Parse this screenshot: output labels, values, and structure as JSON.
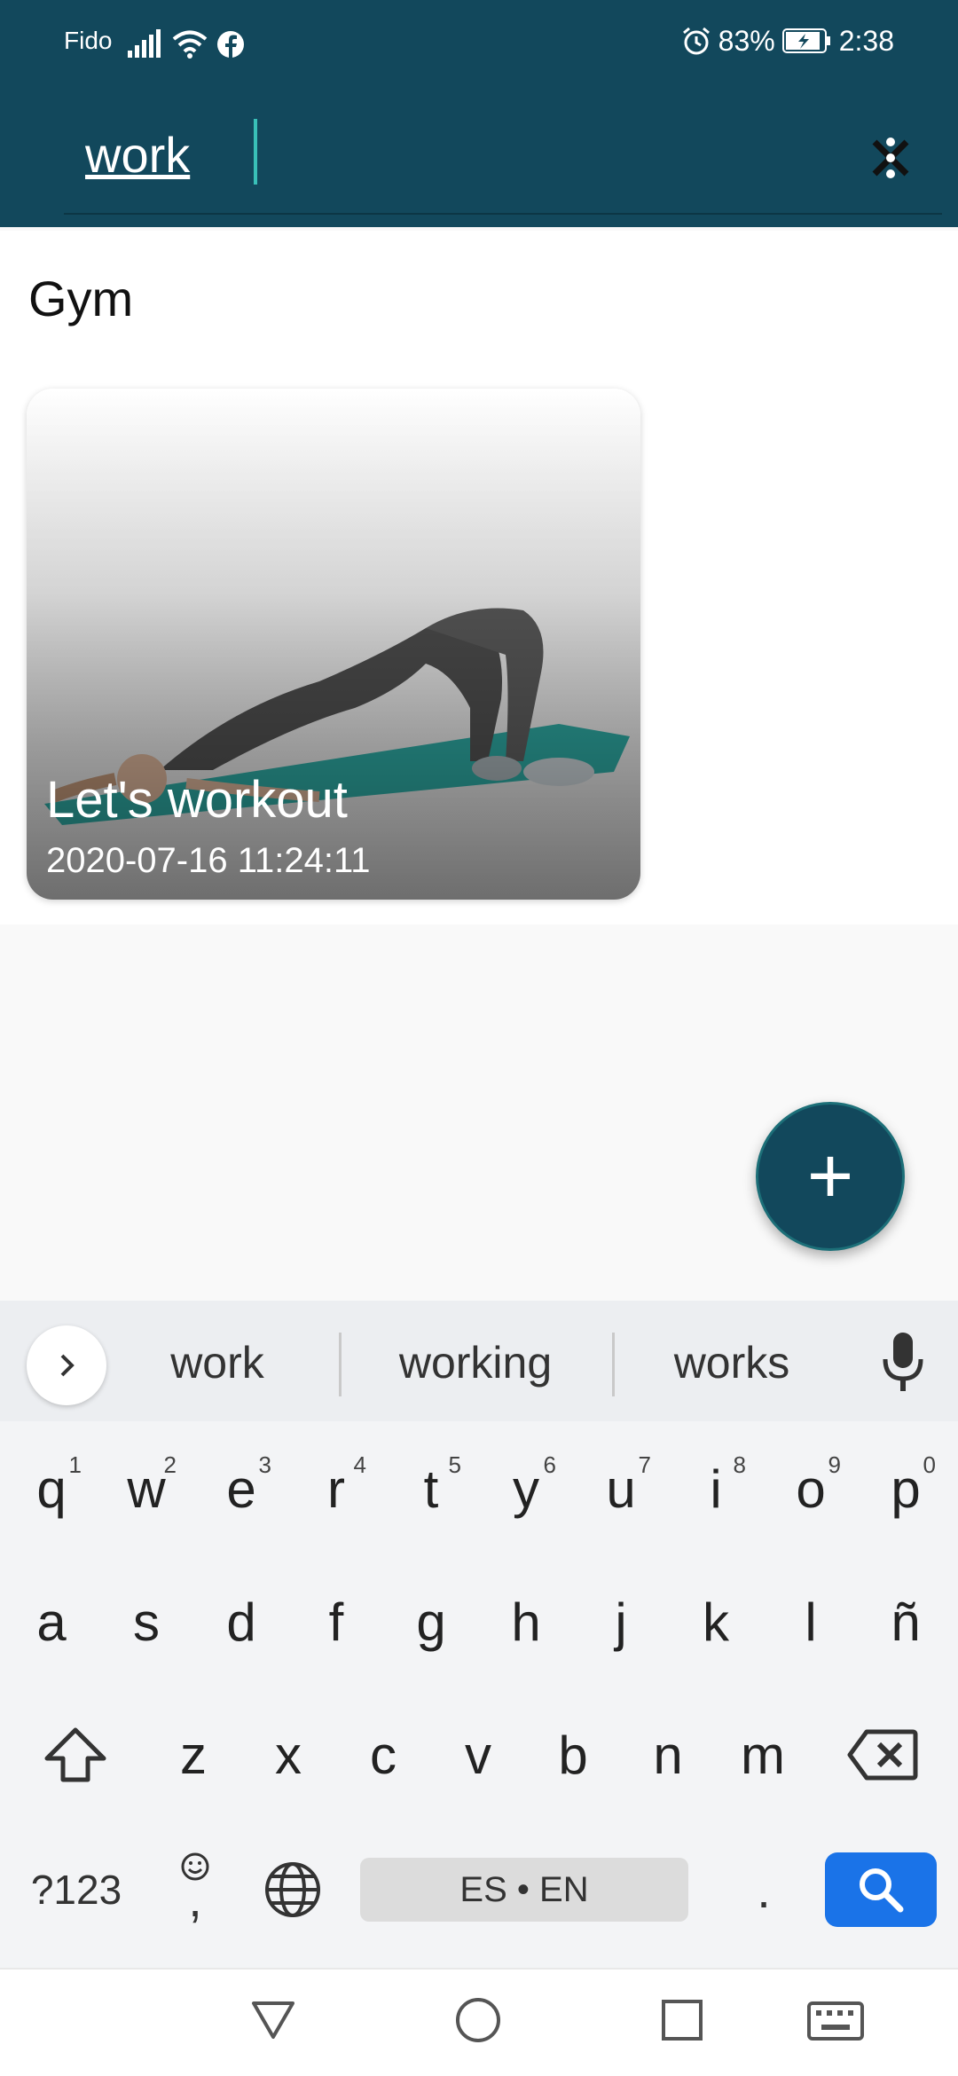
{
  "status_bar": {
    "carrier": "Fido",
    "battery": "83%",
    "time": "2:38"
  },
  "search": {
    "value": "work",
    "placeholder": ""
  },
  "section": {
    "title": "Gym"
  },
  "card": {
    "title": "Let's workout",
    "date": "2020-07-16 11:24:11"
  },
  "fab": {
    "label": "+"
  },
  "keyboard": {
    "suggestions": [
      "work",
      "working",
      "works"
    ],
    "row1": [
      {
        "key": "q",
        "hint": "1"
      },
      {
        "key": "w",
        "hint": "2"
      },
      {
        "key": "e",
        "hint": "3"
      },
      {
        "key": "r",
        "hint": "4"
      },
      {
        "key": "t",
        "hint": "5"
      },
      {
        "key": "y",
        "hint": "6"
      },
      {
        "key": "u",
        "hint": "7"
      },
      {
        "key": "i",
        "hint": "8"
      },
      {
        "key": "o",
        "hint": "9"
      },
      {
        "key": "p",
        "hint": "0"
      }
    ],
    "row2": [
      "a",
      "s",
      "d",
      "f",
      "g",
      "h",
      "j",
      "k",
      "l",
      "ñ"
    ],
    "row3": [
      "z",
      "x",
      "c",
      "v",
      "b",
      "n",
      "m"
    ],
    "symbols_label": "?123",
    "comma_label": ",",
    "space_label": "ES • EN",
    "period_label": "."
  },
  "colors": {
    "appbar": "#12485c",
    "accent_caret": "#39c0b8",
    "search_key": "#1a73e8"
  },
  "icons": [
    "signal-icon",
    "wifi-icon",
    "facebook-icon",
    "alarm-icon",
    "battery-charging-icon",
    "close-icon",
    "chevron-right-icon",
    "microphone-icon",
    "shift-icon",
    "backspace-icon",
    "emoji-icon",
    "globe-icon",
    "search-icon",
    "back-icon",
    "home-icon",
    "recents-icon",
    "keyboard-icon"
  ]
}
